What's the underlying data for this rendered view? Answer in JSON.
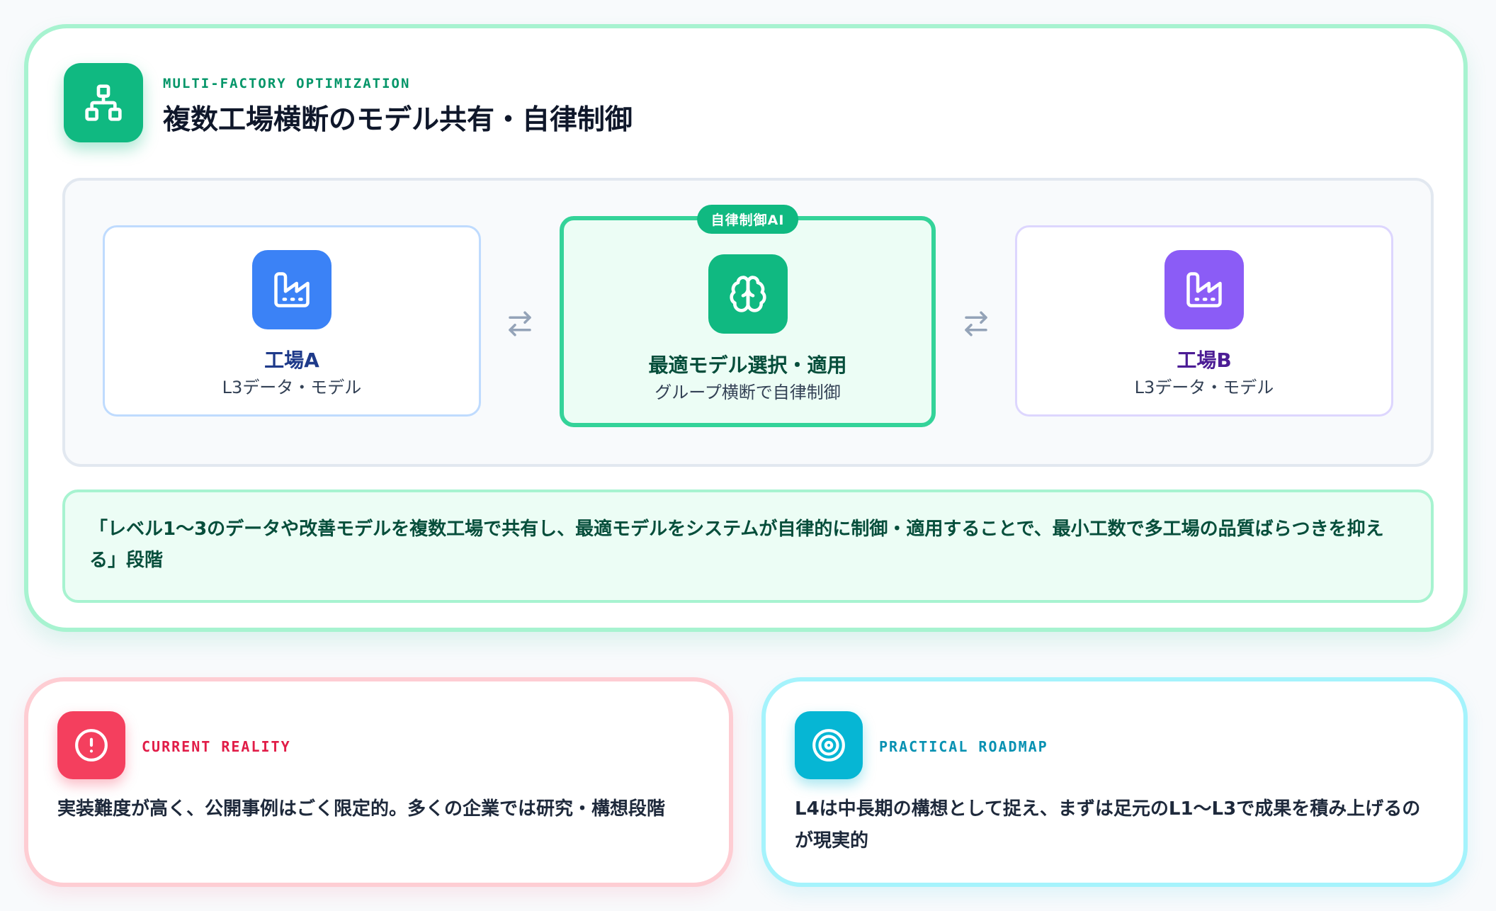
{
  "header": {
    "kicker": "MULTI-FACTORY OPTIMIZATION",
    "title": "複数工場横断のモデル共有・自律制御",
    "icon": "network-icon"
  },
  "diagram": {
    "factory_a": {
      "title": "工場A",
      "subtitle": "L3データ・モデル",
      "icon": "factory-icon",
      "color": "#3b82f6"
    },
    "center": {
      "badge": "自律制御AI",
      "title": "最適モデル選択・適用",
      "subtitle": "グループ横断で自律制御",
      "icon": "brain-icon",
      "color": "#10b981"
    },
    "factory_b": {
      "title": "工場B",
      "subtitle": "L3データ・モデル",
      "icon": "factory-icon",
      "color": "#8b5cf6"
    },
    "connector_icon": "swap-arrows-icon"
  },
  "quote": {
    "text": "「レベル1〜3のデータや改善モデルを複数工場で共有し、最適モデルをシステムが自律的に制御・適用することで、最小工数で多工場の品質ばらつきを抑える」段階"
  },
  "cards": {
    "reality": {
      "kicker": "CURRENT REALITY",
      "text": "実装難度が高く、公開事例はごく限定的。多くの企業では研究・構想段階",
      "icon": "alert-circle-icon",
      "color": "#f43f5e"
    },
    "roadmap": {
      "kicker": "PRACTICAL ROADMAP",
      "text": "L4は中長期の構想として捉え、まずは足元のL1〜L3で成果を積み上げるのが現実的",
      "icon": "target-icon",
      "color": "#06b6d4"
    }
  }
}
